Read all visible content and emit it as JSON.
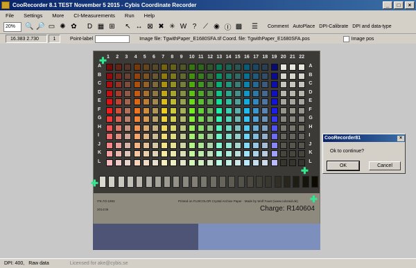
{
  "window": {
    "title": "CooRecorder 8.1 TEST November 5 2015 - Cybis Coordinate Recorder",
    "min": "_",
    "max": "□",
    "close": "×"
  },
  "menu": [
    "File",
    "Settings",
    "More",
    "CI-Measurements",
    "Run",
    "Help"
  ],
  "toolbar": {
    "zoom": "20%",
    "buttons": [
      {
        "name": "zoom-in-icon",
        "glyph": "🔍"
      },
      {
        "name": "zoom-out-icon",
        "glyph": "🔎"
      },
      {
        "name": "image-window-icon",
        "glyph": "▭"
      },
      {
        "name": "bulb-icon",
        "glyph": "✺"
      },
      {
        "name": "flower-icon",
        "glyph": "✿"
      },
      {
        "name": "sep",
        "glyph": ""
      },
      {
        "name": "d-tool-icon",
        "glyph": "D"
      },
      {
        "name": "pattern-icon",
        "glyph": "▦"
      },
      {
        "name": "grid-icon",
        "glyph": "⊞"
      },
      {
        "name": "sep",
        "glyph": ""
      },
      {
        "name": "pointer-icon",
        "glyph": "↖"
      },
      {
        "name": "move-arrows-icon",
        "glyph": "↔"
      },
      {
        "name": "cross-box-icon",
        "glyph": "⊠"
      },
      {
        "name": "delete-icon",
        "glyph": "✖"
      },
      {
        "name": "star-icon",
        "glyph": "✳"
      },
      {
        "name": "w-icon",
        "glyph": "W"
      },
      {
        "name": "question-icon",
        "glyph": "?"
      },
      {
        "name": "line-icon",
        "glyph": "⟋"
      },
      {
        "name": "ring-icon",
        "glyph": "◉"
      },
      {
        "name": "lb-icon",
        "glyph": "Ⓘ"
      },
      {
        "name": "color-gradient-icon",
        "glyph": "▩"
      },
      {
        "name": "sep",
        "glyph": ""
      },
      {
        "name": "list-icon",
        "glyph": "☰"
      }
    ],
    "text_buttons": [
      "Comment",
      "AutoPlace",
      "DPI-Calibrate",
      "DPI and data-type"
    ]
  },
  "coordbar": {
    "coords": "16.383  2.730",
    "point_number": "1",
    "point_label": "Point-label",
    "image_info": "Image file: TgwithPaper_E1680SFA.tif  Coord. file: TgwithPaper_E1680SFA.pos",
    "image_pos": "Image pos"
  },
  "target": {
    "columns": [
      "1",
      "2",
      "3",
      "4",
      "5",
      "6",
      "7",
      "8",
      "9",
      "10",
      "11",
      "12",
      "13",
      "14",
      "15",
      "16",
      "17",
      "18",
      "19",
      "20",
      "21",
      "22"
    ],
    "rows": [
      "A",
      "B",
      "C",
      "D",
      "E",
      "F",
      "G",
      "H",
      "I",
      "J",
      "K",
      "L"
    ],
    "gray_count": "24",
    "footer_left": "IT8.7/2-1993",
    "footer_date": "2014:06",
    "footer_middle": "Printed on FUJICOLOR Crystal Archive Paper  ·  Made by Wolf Faust (www.coloraid.de)",
    "charge": "Charge: R140604"
  },
  "status": {
    "dpi": "DPI: 400,",
    "data": "Raw data",
    "licensed": "Licensed for ake@cybis.se"
  },
  "dialog": {
    "title": "CooRecorder81",
    "close": "×",
    "message": "Ok to continue?",
    "ok": "OK",
    "cancel": "Cancel"
  },
  "colors": {
    "titlebar": "#0a246a",
    "marker": "#30e890",
    "background": "#d4d0c8"
  }
}
